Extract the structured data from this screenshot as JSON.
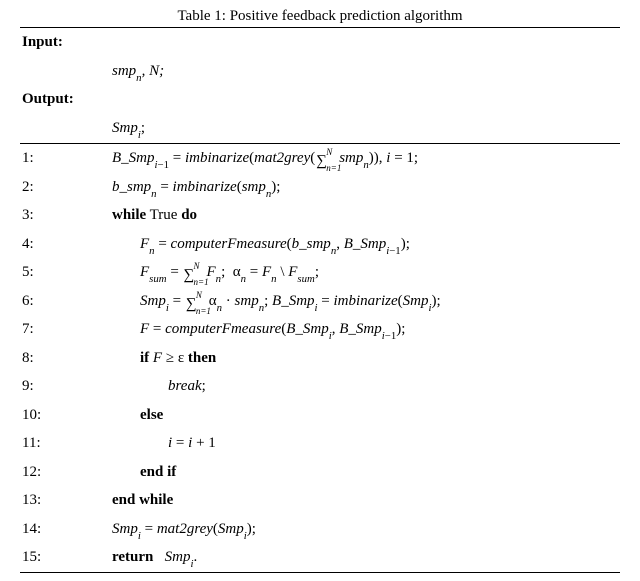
{
  "caption": "Table 1: Positive feedback prediction algorithm",
  "labels": {
    "input": "Input",
    "output": "Output"
  },
  "input_line": "smp",
  "input_sub": "n",
  "input_tail": ", N;",
  "output_line": "Smp",
  "output_sub": "i",
  "output_tail": ";",
  "lines": [
    {
      "no": "1:",
      "indent": 0
    },
    {
      "no": "2:",
      "indent": 0
    },
    {
      "no": "3:",
      "indent": 0
    },
    {
      "no": "4:",
      "indent": 1
    },
    {
      "no": "5:",
      "indent": 1
    },
    {
      "no": "6:",
      "indent": 1
    },
    {
      "no": "7:",
      "indent": 1
    },
    {
      "no": "8:",
      "indent": 1
    },
    {
      "no": "9:",
      "indent": 2
    },
    {
      "no": "10:",
      "indent": 1
    },
    {
      "no": "11:",
      "indent": 2
    },
    {
      "no": "12:",
      "indent": 1
    },
    {
      "no": "13:",
      "indent": 0
    },
    {
      "no": "14:",
      "indent": 0
    },
    {
      "no": "15:",
      "indent": 0
    }
  ],
  "kw": {
    "while": "while",
    "do": "do",
    "if": "if",
    "then": "then",
    "else": "else",
    "endif": "end if",
    "endwhile": "end while",
    "return": "return",
    "break": "break",
    "true": "True"
  },
  "sym": {
    "BSmp": "B_Smp",
    "bsmp": "b_smp",
    "smp": "smp",
    "Smp": "Smp",
    "imb": "imbinarize",
    "m2g": "mat2grey",
    "cfm": "computerFmeasure",
    "F": "F",
    "Fn": "F",
    "Fsum": "F",
    "alpha": "α",
    "eps": "ε",
    "i": "i",
    "n": "n",
    "N": "N",
    "sumlabel": "sum"
  }
}
